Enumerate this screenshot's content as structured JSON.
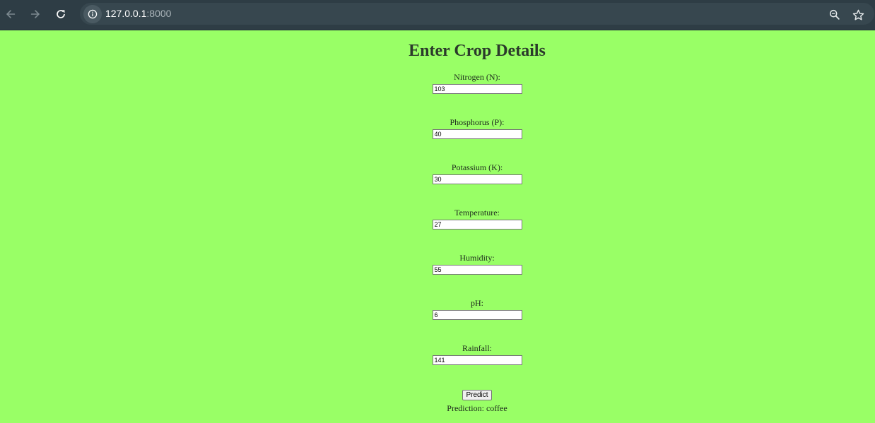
{
  "browser": {
    "url_host": "127.0.0.1",
    "url_port": ":8000"
  },
  "form": {
    "title": "Enter Crop Details",
    "fields": [
      {
        "label": "Nitrogen (N):",
        "value": "103"
      },
      {
        "label": "Phosphorus (P):",
        "value": "40"
      },
      {
        "label": "Potassium (K):",
        "value": "30"
      },
      {
        "label": "Temperature:",
        "value": "27"
      },
      {
        "label": "Humidity:",
        "value": "55"
      },
      {
        "label": "pH:",
        "value": "6"
      },
      {
        "label": "Rainfall:",
        "value": "141"
      }
    ],
    "submit_label": "Predict",
    "prediction_text": "Prediction: coffee"
  }
}
